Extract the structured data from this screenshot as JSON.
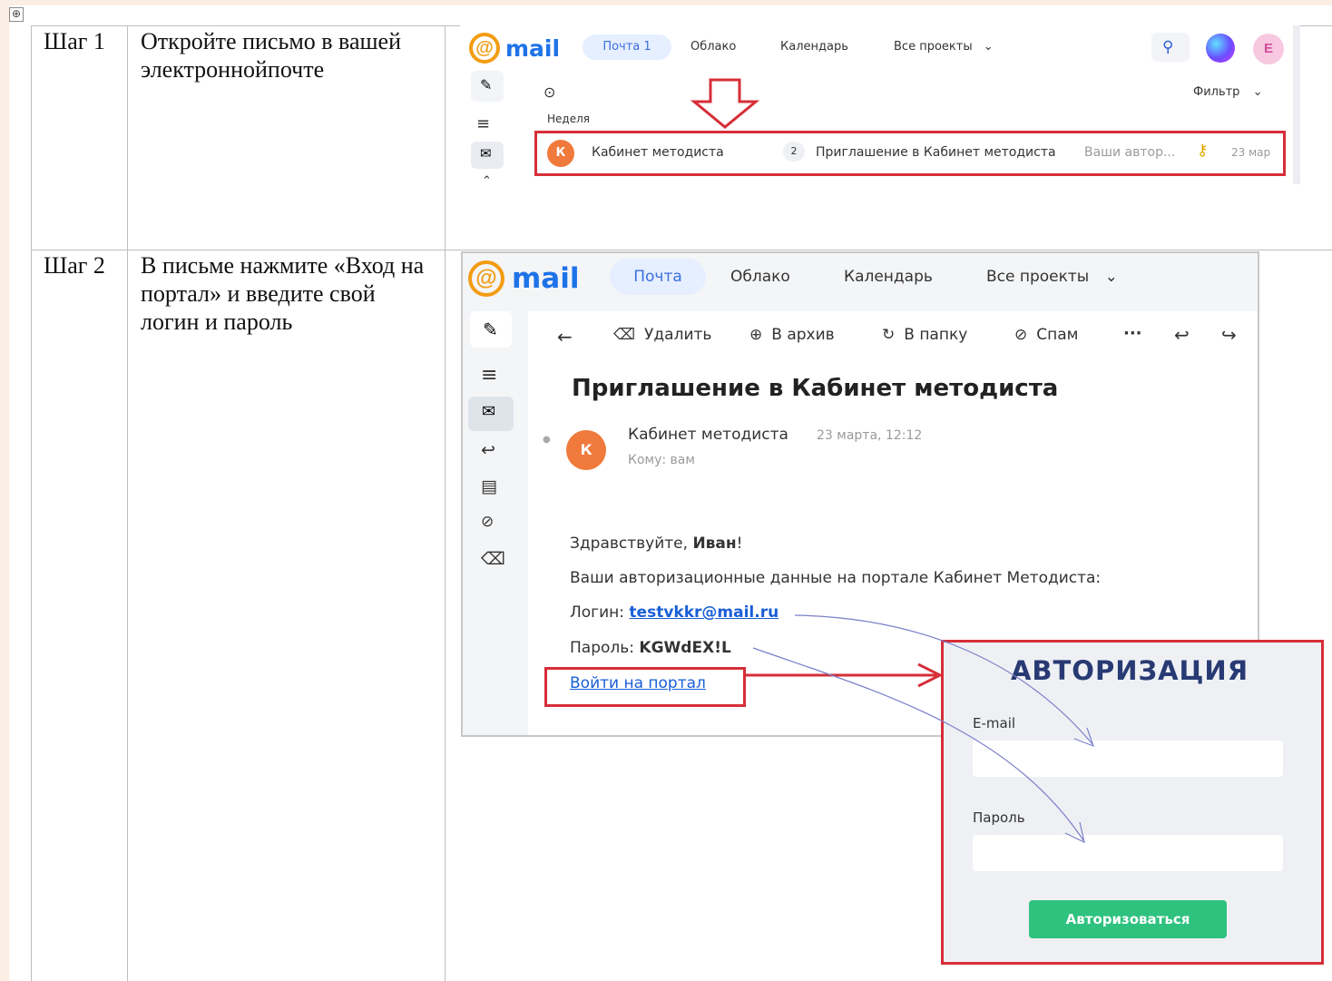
{
  "table_handle": "⊕",
  "steps": [
    {
      "label": "Шаг 1",
      "text": "Откройте письмо в вашей электроннойпочте"
    },
    {
      "label": "Шаг 2",
      "text": "В письме нажмите «Вход на портал» и введите свой логин и пароль"
    }
  ],
  "mail1": {
    "logo_at": "@",
    "logo_word": "mail",
    "nav": {
      "mail": "Почта 1",
      "cloud": "Облако",
      "calendar": "Календарь",
      "projects": "Все проекты"
    },
    "filter": "Фильтр",
    "week": "Неделя",
    "row": {
      "avatar": "К",
      "sender": "Кабинет методиста",
      "count": "2",
      "subject": "Приглашение в Кабинет методиста",
      "preview": "Ваши автор...",
      "date": "23 мар"
    },
    "profile_initial": "Е"
  },
  "mail2": {
    "logo_at": "@",
    "logo_word": "mail",
    "nav": {
      "mail": "Почта",
      "cloud": "Облако",
      "calendar": "Календарь",
      "projects": "Все проекты"
    },
    "toolbar": {
      "delete": "Удалить",
      "archive": "В архив",
      "folder": "В папку",
      "spam": "Спам",
      "more": "···"
    },
    "subject": "Приглашение в Кабинет методиста",
    "sender": "Кабинет методиста",
    "date": "23 марта, 12:12",
    "to": "Кому: вам",
    "avatar": "К",
    "greeting_prefix": "Здравствуйте, ",
    "greeting_name": "Иван",
    "greeting_suffix": "!",
    "auth_line": "Ваши авторизационные данные на портале Кабинет Методиста:",
    "login_label": "Логин: ",
    "login_value": "testvkkr@mail.ru",
    "password_label": "Пароль: ",
    "password_value": "KGWdEX!L",
    "portal_link": "Войти на портал"
  },
  "auth_panel": {
    "title": "АВТОРИЗАЦИЯ",
    "email_label": "E-mail",
    "password_label": "Пароль",
    "button": "Авторизоваться"
  },
  "colors": {
    "highlight_red": "#d62e38",
    "mail_blue": "#1e73e8",
    "logo_orange": "#f39c12",
    "button_green": "#2ec27e"
  }
}
